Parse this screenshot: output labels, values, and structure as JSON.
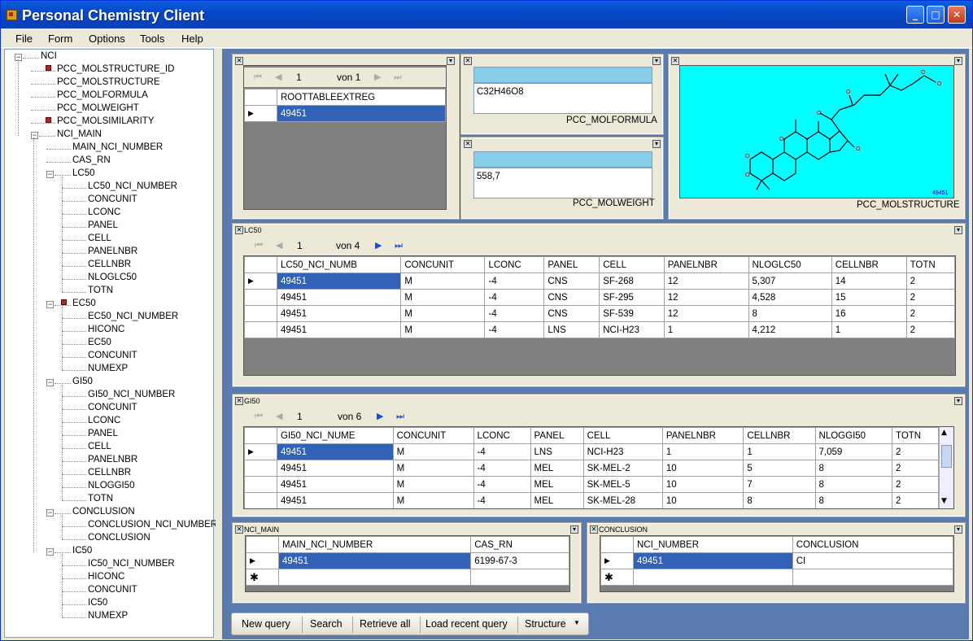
{
  "window": {
    "title": "Personal Chemistry Client"
  },
  "menu": [
    "File",
    "Form",
    "Options",
    "Tools",
    "Help"
  ],
  "tree": {
    "root": "NCI",
    "top": [
      "PCC_MOLSTRUCTURE_ID",
      "PCC_MOLSTRUCTURE",
      "PCC_MOLFORMULA",
      "PCC_MOLWEIGHT",
      "PCC_MOLSIMILARITY"
    ],
    "nci_main": "NCI_MAIN",
    "nci_main_fields": [
      "MAIN_NCI_NUMBER",
      "CAS_RN"
    ],
    "lc50": "LC50",
    "lc50_fields": [
      "LC50_NCI_NUMBER",
      "CONCUNIT",
      "LCONC",
      "PANEL",
      "CELL",
      "PANELNBR",
      "CELLNBR",
      "NLOGLC50",
      "TOTN"
    ],
    "ec50": "EC50",
    "ec50_fields": [
      "EC50_NCI_NUMBER",
      "HICONC",
      "EC50",
      "CONCUNIT",
      "NUMEXP"
    ],
    "gi50": "GI50",
    "gi50_fields": [
      "GI50_NCI_NUMBER",
      "CONCUNIT",
      "LCONC",
      "PANEL",
      "CELL",
      "PANELNBR",
      "CELLNBR",
      "NLOGGI50",
      "TOTN"
    ],
    "conclusion": "CONCLUSION",
    "conclusion_fields": [
      "CONCLUSION_NCI_NUMBER",
      "CONCLUSION"
    ],
    "ic50": "IC50",
    "ic50_fields": [
      "IC50_NCI_NUMBER",
      "HICONC",
      "CONCUNIT",
      "IC50",
      "NUMEXP"
    ]
  },
  "root_panel": {
    "page": "1",
    "of": "von 1",
    "header": "ROOTTABLEEXTREG",
    "value": "49451"
  },
  "formula_panel": {
    "value": "C32H46O8",
    "label": "PCC_MOLFORMULA"
  },
  "weight_panel": {
    "value": "558,7",
    "label": "PCC_MOLWEIGHT"
  },
  "structure_panel": {
    "label": "PCC_MOLSTRUCTURE",
    "id": "49451"
  },
  "lc50_panel": {
    "title": "LC50",
    "page": "1",
    "of": "von 4",
    "columns": [
      "LC50_NCI_NUMB",
      "CONCUNIT",
      "LCONC",
      "PANEL",
      "CELL",
      "PANELNBR",
      "NLOGLC50",
      "CELLNBR",
      "TOTN"
    ],
    "rows": [
      [
        "49451",
        "M",
        "-4",
        "CNS",
        "SF-268",
        "12",
        "5,307",
        "14",
        "2"
      ],
      [
        "49451",
        "M",
        "-4",
        "CNS",
        "SF-295",
        "12",
        "4,528",
        "15",
        "2"
      ],
      [
        "49451",
        "M",
        "-4",
        "CNS",
        "SF-539",
        "12",
        "8",
        "16",
        "2"
      ],
      [
        "49451",
        "M",
        "-4",
        "LNS",
        "NCI-H23",
        "1",
        "4,212",
        "1",
        "2"
      ]
    ]
  },
  "gi50_panel": {
    "title": "GI50",
    "page": "1",
    "of": "von 6",
    "columns": [
      "GI50_NCI_NUME",
      "CONCUNIT",
      "LCONC",
      "PANEL",
      "CELL",
      "PANELNBR",
      "CELLNBR",
      "NLOGGI50",
      "TOTN"
    ],
    "rows": [
      [
        "49451",
        "M",
        "-4",
        "LNS",
        "NCI-H23",
        "1",
        "1",
        "7,059",
        "2"
      ],
      [
        "49451",
        "M",
        "-4",
        "MEL",
        "SK-MEL-2",
        "10",
        "5",
        "8",
        "2"
      ],
      [
        "49451",
        "M",
        "-4",
        "MEL",
        "SK-MEL-5",
        "10",
        "7",
        "8",
        "2"
      ],
      [
        "49451",
        "M",
        "-4",
        "MEL",
        "SK-MEL-28",
        "10",
        "8",
        "8",
        "2"
      ]
    ]
  },
  "nci_main_panel": {
    "title": "NCI_MAIN",
    "columns": [
      "MAIN_NCI_NUMBER",
      "CAS_RN"
    ],
    "rows": [
      [
        "49451",
        "6199-67-3"
      ]
    ]
  },
  "conclusion_panel": {
    "title": "CONCLUSION",
    "columns": [
      "NCI_NUMBER",
      "CONCLUSION"
    ],
    "rows": [
      [
        "49451",
        "CI"
      ]
    ]
  },
  "toolbar": {
    "new_query": "New query",
    "search": "Search",
    "retrieve_all": "Retrieve all",
    "load_recent": "Load recent query",
    "structure": "Structure"
  },
  "colors": {
    "selection": "#3162b5",
    "molecule_bg": "#00ffff",
    "field_header": "#87ceeb"
  }
}
